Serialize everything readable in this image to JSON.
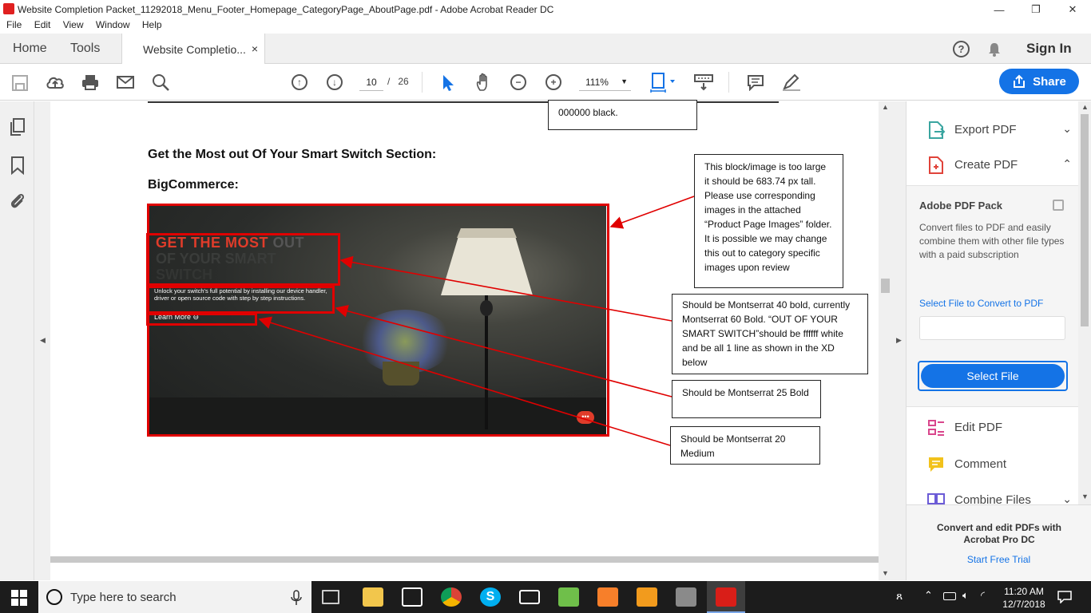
{
  "window": {
    "title": "Website Completion Packet_11292018_Menu_Footer_Homepage_CategoryPage_AboutPage.pdf - Adobe Acrobat Reader DC",
    "minimize_glyph": "—",
    "restore_glyph": "❐",
    "close_glyph": "✕"
  },
  "menu": [
    "File",
    "Edit",
    "View",
    "Window",
    "Help"
  ],
  "tabs": {
    "home": "Home",
    "tools": "Tools",
    "document": "Website Completio...",
    "close_glyph": "×"
  },
  "header_right": {
    "sign_in": "Sign In"
  },
  "toolbar": {
    "current_page": "10",
    "page_separator": "/",
    "total_pages": "26",
    "zoom": "111%",
    "share_label": "Share"
  },
  "document": {
    "top_note_text": "000000 black.",
    "heading": "Get the Most out Of Your Smart Switch Section:",
    "subheading": "BigCommerce:",
    "hero": {
      "title_red": "GET THE MOST",
      "title_grey": " OUT",
      "title_line2": "OF YOUR SMART",
      "title_line3": "SWITCH",
      "body": "Unlock your switch's full potential by installing our device handler, driver or open source code with step by step instructions.",
      "link": "Learn More"
    },
    "notes": [
      "This block/image is too large it should be 683.74 px tall. Please use corresponding images in the attached “Product Page Images” folder. It is possible we may change this out to category specific images upon review",
      "Should be Montserrat 40 bold, currently Montserrat 60 Bold. “OUT OF YOUR SMART SWITCH”should be ffffff white and be all 1 line as shown in the XD below",
      "Should be Montserrat 25 Bold",
      "Should be Montserrat 20 Medium"
    ]
  },
  "right_panel": {
    "export_pdf": "Export PDF",
    "create_pdf": "Create PDF",
    "pack_title": "Adobe PDF Pack",
    "pack_desc": "Convert files to PDF and easily combine them with other file types with a paid subscription",
    "select_link": "Select File to Convert to PDF",
    "select_button": "Select File",
    "edit_pdf": "Edit PDF",
    "comment": "Comment",
    "combine": "Combine Files",
    "promo": "Convert and edit PDFs with Acrobat Pro DC",
    "trial": "Start Free Trial"
  },
  "taskbar": {
    "search_placeholder": "Type here to search",
    "time": "11:20 AM",
    "date": "12/7/2018"
  },
  "colors": {
    "accent": "#1473e6",
    "annotation_red": "#e00000",
    "hero_red": "#e03c2a"
  }
}
